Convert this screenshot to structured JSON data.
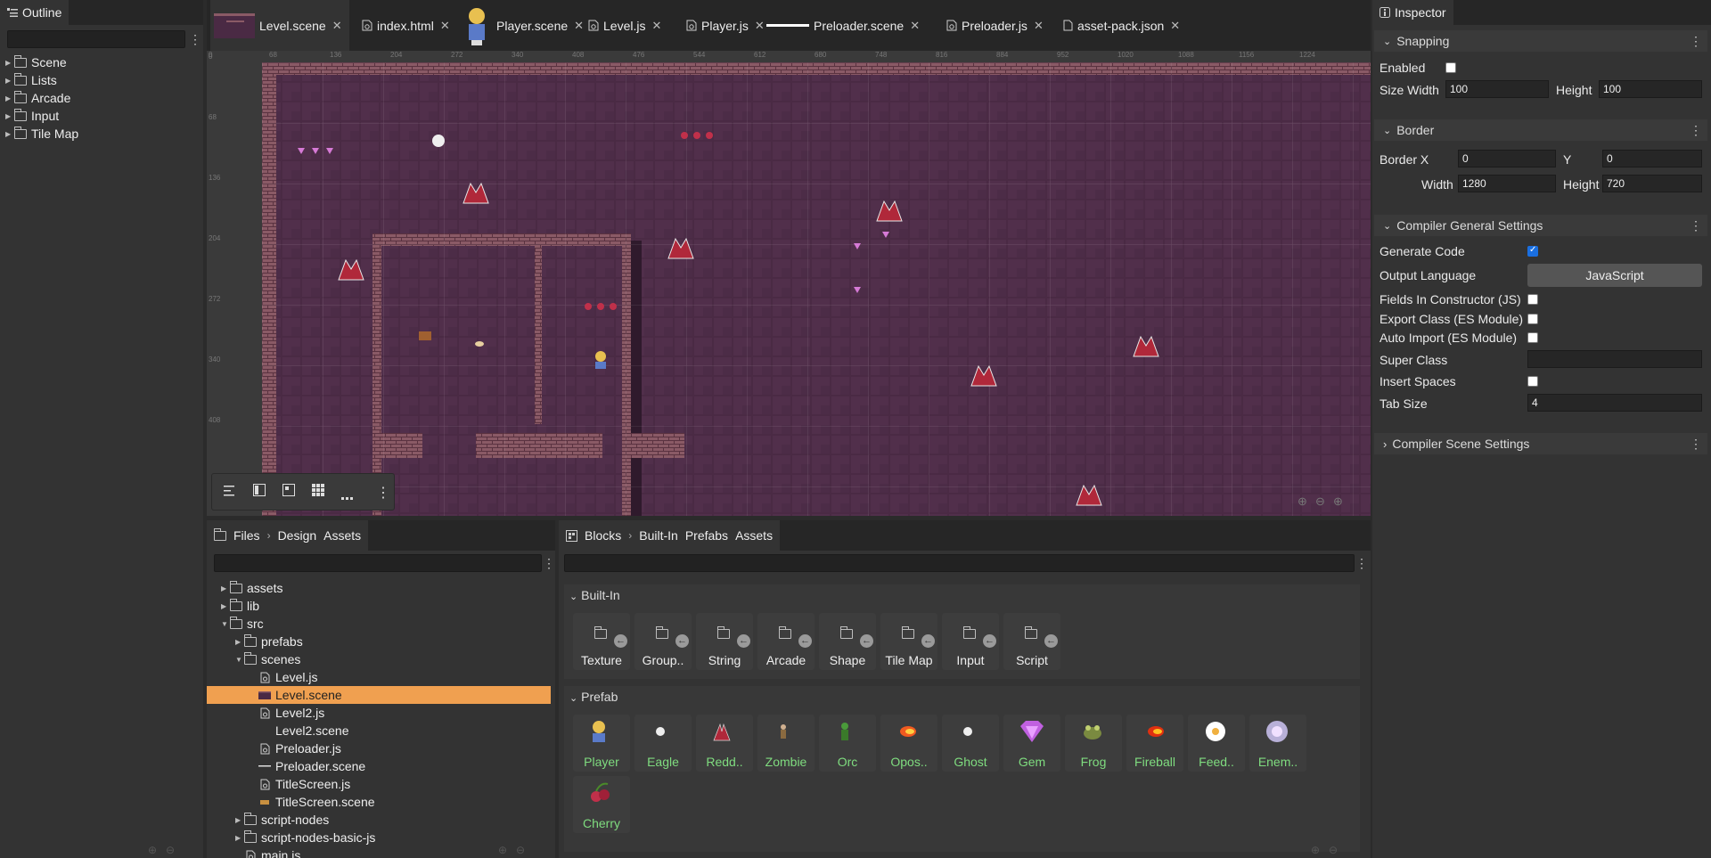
{
  "outline": {
    "title": "Outline",
    "items": [
      "Scene",
      "Lists",
      "Arcade",
      "Input",
      "Tile Map"
    ]
  },
  "editor_tabs": [
    {
      "label": "Level.scene",
      "icon": "scene-thumbnail-icon"
    },
    {
      "label": "index.html",
      "icon": "gear-icon"
    },
    {
      "label": "Player.scene",
      "icon": "player-thumbnail-icon"
    },
    {
      "label": "Level.js",
      "icon": "gear-icon"
    },
    {
      "label": "Player.js",
      "icon": "gear-icon"
    },
    {
      "label": "Preloader.scene",
      "icon": "line-thumbnail-icon"
    },
    {
      "label": "Preloader.js",
      "icon": "gear-icon"
    },
    {
      "label": "asset-pack.json",
      "icon": "file-icon"
    }
  ],
  "ruler": {
    "top": [
      "0",
      "68",
      "136",
      "204",
      "272",
      "340",
      "408",
      "476",
      "544",
      "612",
      "680",
      "748",
      "816",
      "884",
      "952",
      "1020",
      "1088",
      "1156",
      "1224"
    ],
    "left": [
      "0",
      "68",
      "136",
      "204",
      "272",
      "340",
      "408"
    ]
  },
  "files": {
    "breadcrumb": [
      "Files",
      "Design",
      "Assets"
    ],
    "tree": [
      {
        "label": "assets",
        "depth": 0,
        "type": "folder",
        "state": "closed"
      },
      {
        "label": "lib",
        "depth": 0,
        "type": "folder",
        "state": "closed"
      },
      {
        "label": "src",
        "depth": 0,
        "type": "folder",
        "state": "open"
      },
      {
        "label": "prefabs",
        "depth": 1,
        "type": "folder",
        "state": "closed"
      },
      {
        "label": "scenes",
        "depth": 1,
        "type": "folder",
        "state": "open"
      },
      {
        "label": "Level.js",
        "depth": 2,
        "type": "js"
      },
      {
        "label": "Level.scene",
        "depth": 2,
        "type": "scene",
        "selected": true
      },
      {
        "label": "Level2.js",
        "depth": 2,
        "type": "js"
      },
      {
        "label": "Level2.scene",
        "depth": 2,
        "type": "blank"
      },
      {
        "label": "Preloader.js",
        "depth": 2,
        "type": "js"
      },
      {
        "label": "Preloader.scene",
        "depth": 2,
        "type": "line"
      },
      {
        "label": "TitleScreen.js",
        "depth": 2,
        "type": "js"
      },
      {
        "label": "TitleScreen.scene",
        "depth": 2,
        "type": "sprite"
      },
      {
        "label": "script-nodes",
        "depth": 1,
        "type": "folder",
        "state": "closed"
      },
      {
        "label": "script-nodes-basic-js",
        "depth": 1,
        "type": "folder",
        "state": "closed"
      },
      {
        "label": "main.js",
        "depth": 1,
        "type": "js"
      }
    ]
  },
  "blocks": {
    "breadcrumb": [
      "Blocks",
      "Built-In",
      "Prefabs",
      "Assets"
    ],
    "builtin_title": "Built-In",
    "builtin": [
      "Texture",
      "Group..",
      "String",
      "Arcade",
      "Shape",
      "Tile Map",
      "Input",
      "Script"
    ],
    "prefab_title": "Prefab",
    "prefabs": [
      {
        "label": "Player",
        "icon": "player-sprite-icon"
      },
      {
        "label": "Eagle",
        "icon": "eagle-sprite-icon"
      },
      {
        "label": "Redd..",
        "icon": "redd-sprite-icon"
      },
      {
        "label": "Zombie",
        "icon": "zombie-sprite-icon"
      },
      {
        "label": "Orc",
        "icon": "orc-sprite-icon"
      },
      {
        "label": "Opos..",
        "icon": "opossum-sprite-icon"
      },
      {
        "label": "Ghost",
        "icon": "ghost-sprite-icon"
      },
      {
        "label": "Gem",
        "icon": "gem-sprite-icon"
      },
      {
        "label": "Frog",
        "icon": "frog-sprite-icon"
      },
      {
        "label": "Fireball",
        "icon": "fireball-sprite-icon"
      },
      {
        "label": "Feed..",
        "icon": "feed-sprite-icon"
      },
      {
        "label": "Enem..",
        "icon": "enemy-sprite-icon"
      },
      {
        "label": "Cherry",
        "icon": "cherry-sprite-icon"
      }
    ]
  },
  "inspector": {
    "title": "Inspector",
    "snapping": {
      "title": "Snapping",
      "enabled_label": "Enabled",
      "enabled": false,
      "size_width_label": "Size Width",
      "size_width": "100",
      "height_label": "Height",
      "height": "100"
    },
    "border": {
      "title": "Border",
      "x_label": "Border X",
      "x": "0",
      "y_label": "Y",
      "y": "0",
      "width_label": "Width",
      "width": "1280",
      "height_label": "Height",
      "height": "720"
    },
    "compiler": {
      "title": "Compiler General Settings",
      "generate_code_label": "Generate Code",
      "generate_code": true,
      "output_language_label": "Output Language",
      "output_language": "JavaScript",
      "fields_in_constructor_label": "Fields In Constructor (JS)",
      "export_class_label": "Export Class (ES Module)",
      "auto_import_label": "Auto Import (ES Module)",
      "super_class_label": "Super Class",
      "super_class": "",
      "insert_spaces_label": "Insert Spaces",
      "tab_size_label": "Tab Size",
      "tab_size": "4"
    },
    "compiler_scene": {
      "title": "Compiler Scene Settings"
    }
  },
  "colors": {
    "accent": "#f0a050",
    "scene_floor": "#4a2a44",
    "wall": "#7a4a58",
    "checkbox_on": "#1a6fe0",
    "prefab_label": "#7fdc7f"
  }
}
